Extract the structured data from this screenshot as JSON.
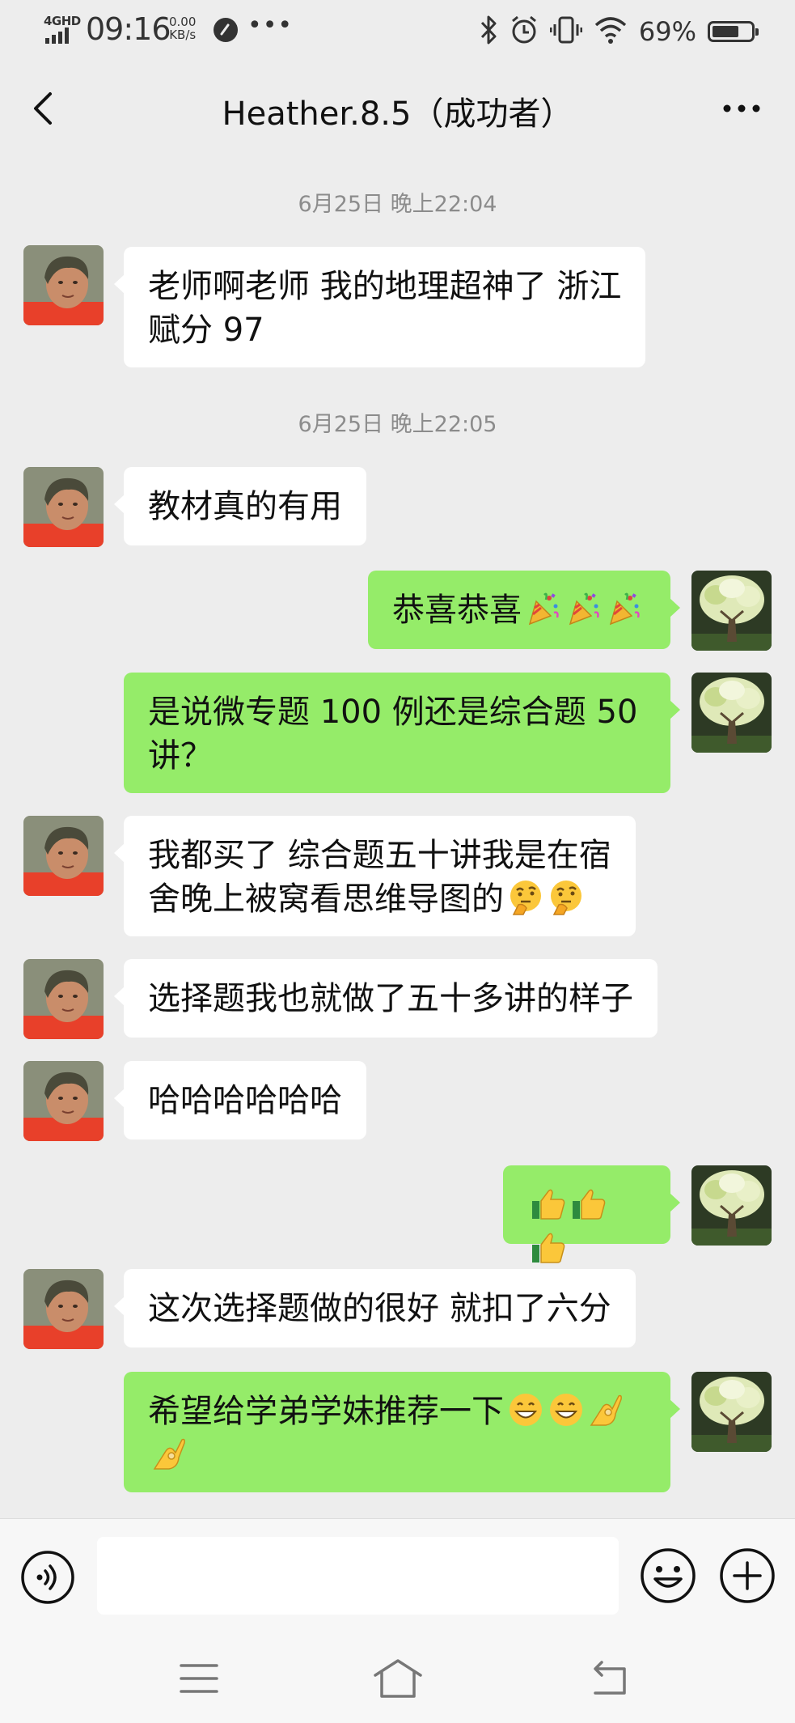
{
  "status_bar": {
    "network": "4GHD",
    "time": "09:16",
    "speed_value": "0.00",
    "speed_unit": "KB/s",
    "more": "•••",
    "battery_percent": "69%",
    "battery_level": 0.69,
    "icons": [
      "signal-icon",
      "app-notification-icon",
      "bluetooth-icon",
      "alarm-icon",
      "vibrate-icon",
      "wifi-icon",
      "battery-icon"
    ]
  },
  "header": {
    "title": "Heather.8.5（成功者）",
    "back_icon": "chevron-left-icon",
    "more_icon": "more-dots-icon"
  },
  "messages": [
    {
      "type": "timestamp",
      "text": "6月25日 晚上22:04"
    },
    {
      "type": "message",
      "sender": "contact",
      "text": "老师啊老师 我的地理超神了 浙江\n赋分 97"
    },
    {
      "type": "timestamp",
      "text": "6月25日 晚上22:05"
    },
    {
      "type": "message",
      "sender": "contact",
      "text": "教材真的有用"
    },
    {
      "type": "message",
      "sender": "me",
      "text": "恭喜恭喜",
      "emojis": [
        "party-popper",
        "party-popper",
        "party-popper"
      ]
    },
    {
      "type": "message",
      "sender": "me",
      "text": "是说微专题 100 例还是综合题 50\n讲？"
    },
    {
      "type": "message",
      "sender": "contact",
      "text": "我都买了 综合题五十讲我是在宿\n舍晚上被窝看思维导图的",
      "emojis": [
        "thinking-face",
        "thinking-face"
      ]
    },
    {
      "type": "message",
      "sender": "contact",
      "text": "选择题我也就做了五十多讲的样子"
    },
    {
      "type": "message",
      "sender": "contact",
      "text": "哈哈哈哈哈哈"
    },
    {
      "type": "message",
      "sender": "me",
      "text": "",
      "emojis": [
        "thumbs-up",
        "thumbs-up",
        "thumbs-up"
      ]
    },
    {
      "type": "message",
      "sender": "contact",
      "text": "这次选择题做的很好 就扣了六分"
    },
    {
      "type": "message",
      "sender": "me",
      "text": "希望给学弟学妹推荐一下",
      "emojis": [
        "grinning-face",
        "grinning-face",
        "ok-hand",
        "ok-hand"
      ]
    }
  ],
  "input_bar": {
    "text_value": "",
    "icons": [
      "voice-icon",
      "emoji-icon",
      "plus-icon"
    ]
  },
  "nav_bar": {
    "icons": [
      "menu-icon",
      "home-icon",
      "back-icon"
    ]
  },
  "colors": {
    "background": "#ededed",
    "my_bubble": "#95ec69",
    "contact_bubble": "#ffffff",
    "timestamp_text": "#8c8c8c",
    "input_bar": "#f7f7f7"
  }
}
